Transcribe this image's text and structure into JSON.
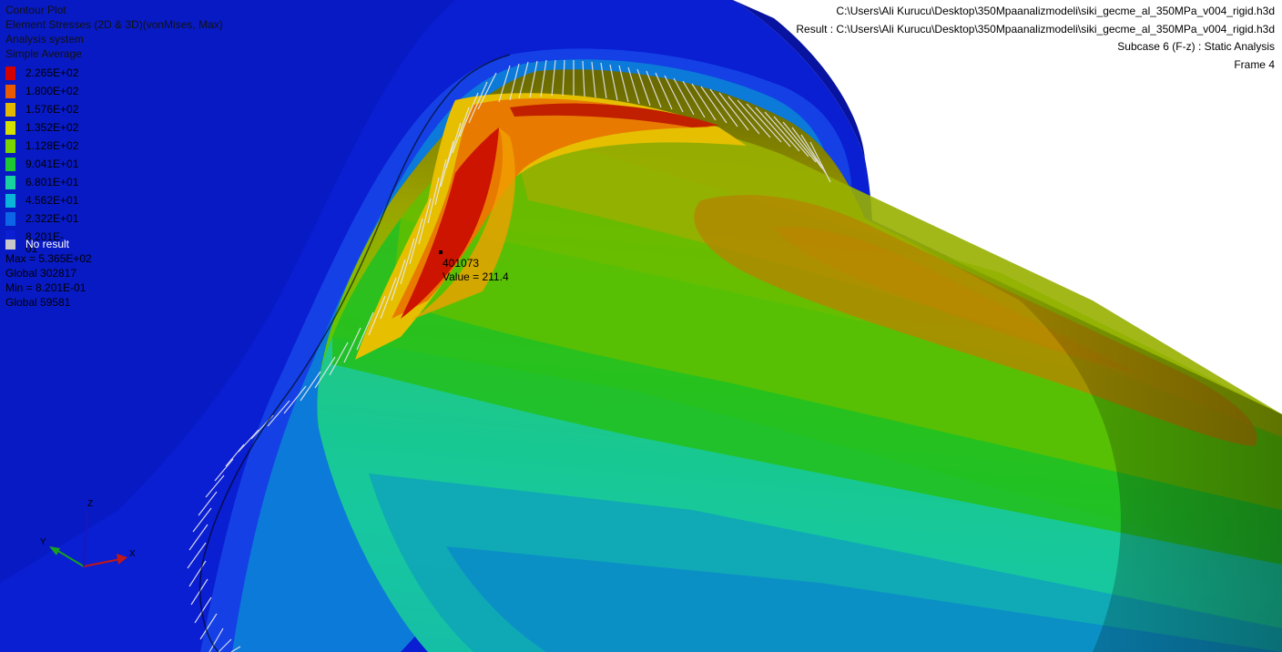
{
  "plot": {
    "title": "Contour Plot",
    "result_type": "Element Stresses (2D & 3D)(vonMises, Max)",
    "coordinate_system": "Analysis system",
    "averaging": "Simple Average"
  },
  "legend": {
    "entries": [
      {
        "label": "2.265E+02",
        "color": "#d40000"
      },
      {
        "label": "1.800E+02",
        "color": "#e85a00"
      },
      {
        "label": "1.576E+02",
        "color": "#e3b800"
      },
      {
        "label": "1.352E+02",
        "color": "#d4e000"
      },
      {
        "label": "1.128E+02",
        "color": "#7ad400"
      },
      {
        "label": "9.041E+01",
        "color": "#1ec832"
      },
      {
        "label": "6.801E+01",
        "color": "#18d2a0"
      },
      {
        "label": "4.562E+01",
        "color": "#0ab4d8"
      },
      {
        "label": "2.322E+01",
        "color": "#0c64e6"
      },
      {
        "label": "8.201E-01",
        "color": "#0a1ed2"
      }
    ],
    "no_result_label": "No result",
    "no_result_color": "#c8c8c8"
  },
  "stats": {
    "max": "Max = 5.365E+02",
    "max_location": "Global 302817",
    "min": "Min = 8.201E-01",
    "min_location": "Global 59581"
  },
  "model_file": "C:\\Users\\Ali Kurucu\\Desktop\\350Mpaanalizmodeli\\siki_gecme_al_350MPa_v004_rigid.h3d",
  "result_file": "Result : C:\\Users\\Ali Kurucu\\Desktop\\350Mpaanalizmodeli\\siki_gecme_al_350MPa_v004_rigid.h3d",
  "subcase": "Subcase 6 (F-z) : Static Analysis",
  "frame": "Frame 4",
  "probe": {
    "id": "401073",
    "value": "Value = 211.4"
  },
  "triad": {
    "x": "X",
    "y": "Y",
    "z": "Z"
  },
  "colors": {
    "background": "#ffffff",
    "mesh_blue": "#0a1ed2",
    "label_text": "#000000"
  }
}
